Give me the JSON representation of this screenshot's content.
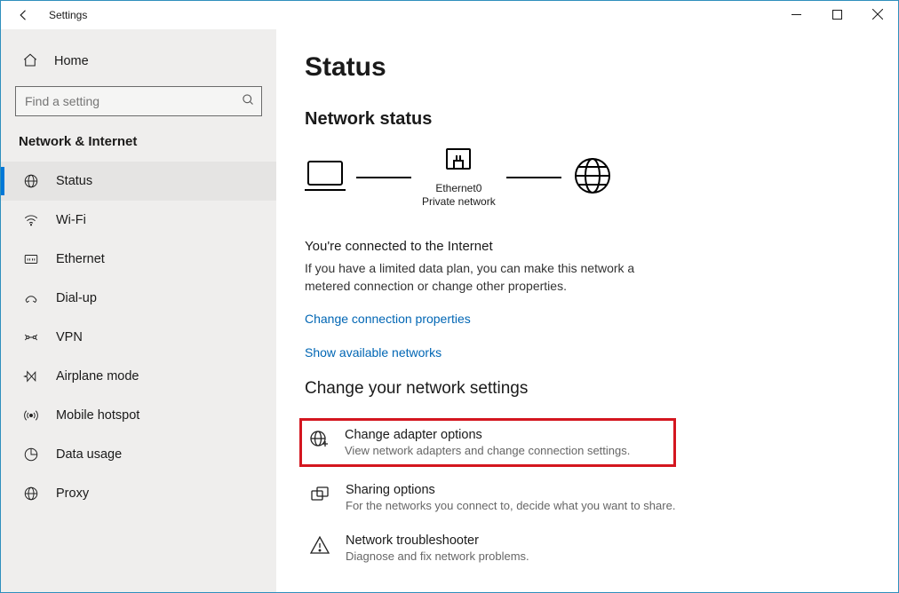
{
  "window": {
    "title": "Settings"
  },
  "sidebar": {
    "home": "Home",
    "searchPlaceholder": "Find a setting",
    "heading": "Network & Internet",
    "items": [
      {
        "label": "Status"
      },
      {
        "label": "Wi-Fi"
      },
      {
        "label": "Ethernet"
      },
      {
        "label": "Dial-up"
      },
      {
        "label": "VPN"
      },
      {
        "label": "Airplane mode"
      },
      {
        "label": "Mobile hotspot"
      },
      {
        "label": "Data usage"
      },
      {
        "label": "Proxy"
      }
    ]
  },
  "page": {
    "title": "Status",
    "netstatus": "Network status",
    "adapter": {
      "name": "Ethernet0",
      "type": "Private network"
    },
    "connected": {
      "h": "You're connected to the Internet",
      "p": "If you have a limited data plan, you can make this network a metered connection or change other properties."
    },
    "links": {
      "changeProps": "Change connection properties",
      "showNets": "Show available networks"
    },
    "changeH": "Change your network settings",
    "options": [
      {
        "title": "Change adapter options",
        "desc": "View network adapters and change connection settings."
      },
      {
        "title": "Sharing options",
        "desc": "For the networks you connect to, decide what you want to share."
      },
      {
        "title": "Network troubleshooter",
        "desc": "Diagnose and fix network problems."
      }
    ]
  }
}
